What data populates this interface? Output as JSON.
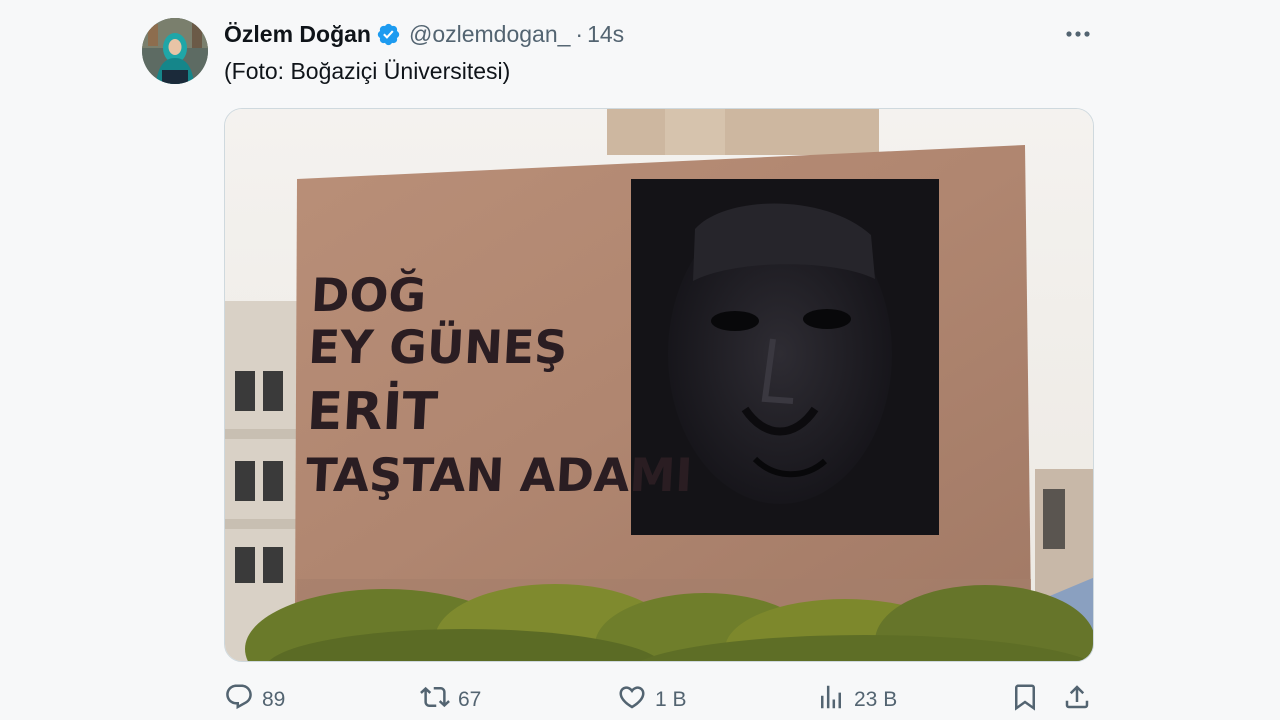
{
  "author": {
    "name": "Özlem Doğan",
    "handle": "@ozlemdogan_",
    "separator": "·",
    "time": "14s",
    "verified": true
  },
  "tweet": {
    "text": "(Foto: Boğaziçi Üniversitesi)"
  },
  "media": {
    "graffiti_lines": [
      "DOĞ",
      "EY GÜNEŞ",
      "ERİT",
      "TAŞTAN ADAMI"
    ]
  },
  "actions": {
    "replies": "89",
    "reposts": "67",
    "likes": "1 B",
    "views": "23 B"
  },
  "colors": {
    "text_primary": "#0f1419",
    "text_secondary": "#536471",
    "verified_blue": "#1d9bf0",
    "background": "#f7f8f9"
  },
  "icons": [
    "verified-badge-icon",
    "more-icon",
    "reply-icon",
    "repost-icon",
    "like-icon",
    "views-icon",
    "bookmark-icon",
    "share-icon"
  ]
}
